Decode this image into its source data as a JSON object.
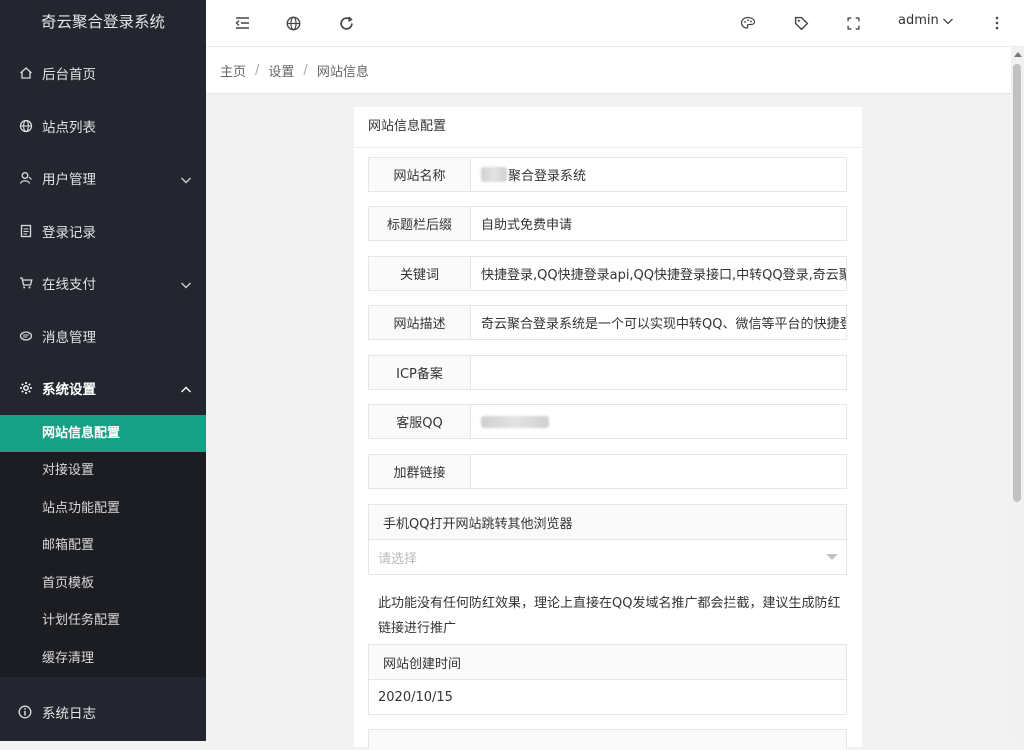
{
  "brand": "奇云聚合登录系统",
  "sidebar": {
    "items": [
      {
        "label": "后台首页",
        "icon": "home-icon"
      },
      {
        "label": "站点列表",
        "icon": "globe-icon"
      },
      {
        "label": "用户管理",
        "icon": "user-icon"
      },
      {
        "label": "登录记录",
        "icon": "doc-icon"
      },
      {
        "label": "在线支付",
        "icon": "cart-icon"
      },
      {
        "label": "消息管理",
        "icon": "message-icon"
      },
      {
        "label": "系统设置",
        "icon": "gear-icon"
      }
    ],
    "sub_items": [
      "网站信息配置",
      "对接设置",
      "站点功能配置",
      "邮箱配置",
      "首页模板",
      "计划任务配置",
      "缓存清理"
    ],
    "bottom": {
      "label": "系统日志",
      "icon": "info-icon"
    }
  },
  "header": {
    "user": "admin"
  },
  "breadcrumb": [
    "主页",
    "设置",
    "网站信息"
  ],
  "form": {
    "title": "网站信息配置",
    "fields": [
      {
        "label": "网站名称",
        "value": "聚合登录系统"
      },
      {
        "label": "标题栏后缀",
        "value": "自助式免费申请"
      },
      {
        "label": "关键词",
        "value": "快捷登录,QQ快捷登录api,QQ快捷登录接口,中转QQ登录,奇云聚"
      },
      {
        "label": "网站描述",
        "value": "奇云聚合登录系统是一个可以实现中转QQ、微信等平台的快捷登"
      },
      {
        "label": "ICP备案",
        "value": ""
      },
      {
        "label": "客服QQ",
        "value": ""
      },
      {
        "label": "加群链接",
        "value": ""
      }
    ],
    "browser_jump": {
      "label": "手机QQ打开网站跳转其他浏览器",
      "placeholder": "请选择"
    },
    "note": "此功能没有任何防红效果，理论上直接在QQ发域名推广都会拦截，建议生成防红链接进行推广",
    "created": {
      "label": "网站创建时间",
      "value": "2020/10/15"
    }
  },
  "colors": {
    "sidebar_bg": "#23262e",
    "active": "#16a085"
  }
}
